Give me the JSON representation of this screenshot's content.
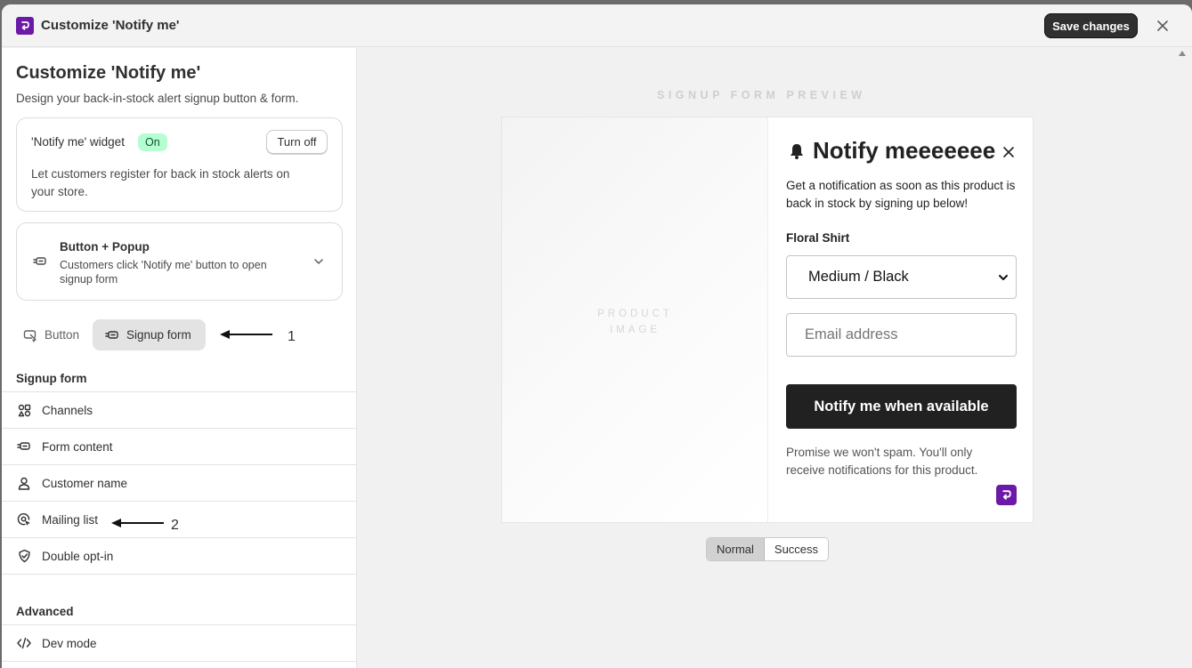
{
  "titlebar": {
    "title": "Customize 'Notify me'",
    "save_label": "Save changes"
  },
  "sidebar": {
    "title": "Customize 'Notify me'",
    "subtitle": "Design your back-in-stock alert signup button & form.",
    "widget": {
      "label": "'Notify me' widget",
      "status": "On",
      "toggle_label": "Turn off",
      "description": "Let customers register for back in stock alerts on your store."
    },
    "mode": {
      "title": "Button + Popup",
      "description": "Customers click 'Notify me' button to open signup form"
    },
    "tabs": [
      {
        "label": "Button",
        "active": false
      },
      {
        "label": "Signup form",
        "active": true
      }
    ],
    "annotations": {
      "one": "1",
      "two": "2"
    },
    "section_signup": "Signup form",
    "signup_items": [
      {
        "label": "Channels",
        "icon": "channels-icon"
      },
      {
        "label": "Form content",
        "icon": "form-content-icon"
      },
      {
        "label": "Customer name",
        "icon": "person-icon"
      },
      {
        "label": "Mailing list",
        "icon": "mailing-list-icon"
      },
      {
        "label": "Double opt-in",
        "icon": "shield-check-icon"
      }
    ],
    "section_advanced": "Advanced",
    "advanced_items": [
      {
        "label": "Dev mode",
        "icon": "code-icon"
      }
    ]
  },
  "preview": {
    "label": "SIGNUP FORM PREVIEW",
    "product_image_label_1": "PRODUCT",
    "product_image_label_2": "IMAGE",
    "heading": "Notify meeeeeee",
    "description": "Get a notification as soon as this product is back in stock by signing up below!",
    "product_name": "Floral Shirt",
    "variant": "Medium / Black",
    "email_placeholder": "Email address",
    "notify_button": "Notify me when available",
    "promise": "Promise we won't spam. You'll only receive notifications for this product.",
    "states": [
      {
        "label": "Normal",
        "active": true
      },
      {
        "label": "Success",
        "active": false
      }
    ]
  },
  "colors": {
    "brand": "#6b19a6",
    "dark": "#303030",
    "badge_bg": "#b4fed2",
    "badge_text": "#0c5132"
  }
}
